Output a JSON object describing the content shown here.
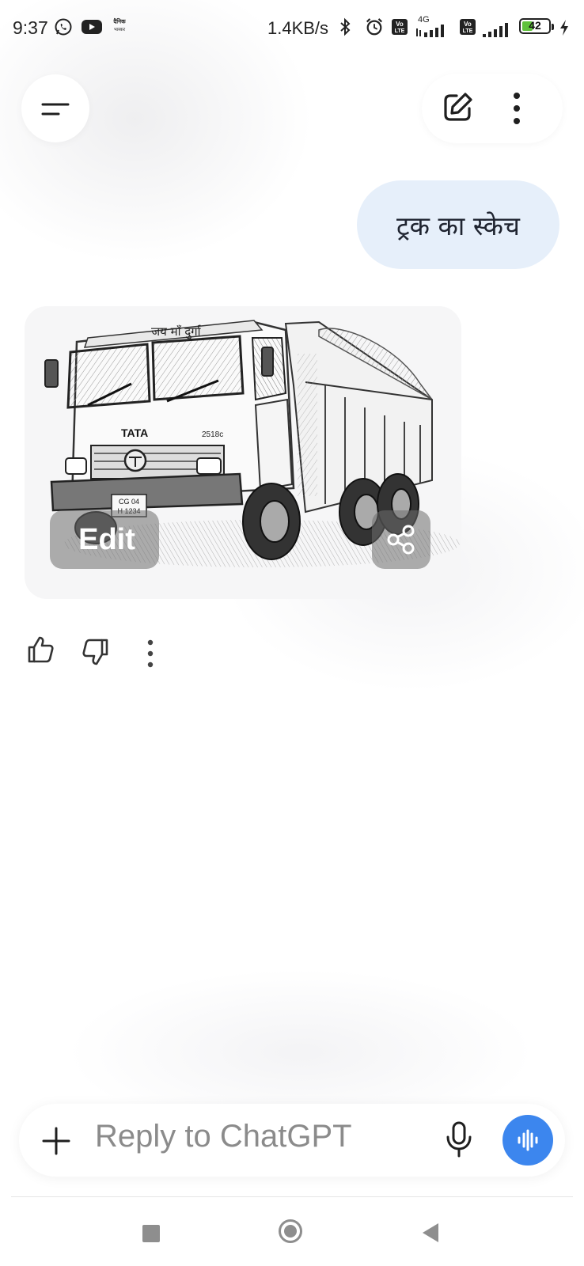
{
  "status_bar": {
    "time": "9:37",
    "left_icons": [
      "whatsapp-icon",
      "youtube-icon",
      "dainik-bhaskar-icon"
    ],
    "dainik_bhaskar_text": "दैनिक भास्कर",
    "net_speed": "1.4KB/s",
    "right_icons": [
      "bluetooth-icon",
      "alarm-icon",
      "volte-icon",
      "signal-4g-icon",
      "volte-icon",
      "signal-icon"
    ],
    "network_type": "4G",
    "volte_label": "Vo LTE",
    "battery_level": "42",
    "battery_fraction": 0.42,
    "charging": true
  },
  "header": {
    "menu_icon": "menu-icon",
    "new_chat_icon": "edit-square-icon",
    "more_icon": "more-vertical-icon"
  },
  "conversation": {
    "user_message": "ट्रक का स्केच",
    "assistant_image": {
      "subject": "pencil sketch of a TATA dump truck",
      "windshield_text": "जय माँ दुर्गा",
      "brand_text": "TATA",
      "model_text": "2518c",
      "plate_line1": "CG 04",
      "plate_line2": "H 1234",
      "edit_label": "Edit",
      "share_icon": "share-icon"
    },
    "feedback_icons": [
      "thumbs-up-icon",
      "thumbs-down-icon",
      "more-vertical-icon"
    ]
  },
  "composer": {
    "plus_icon": "plus-icon",
    "placeholder": "Reply to ChatGPT",
    "mic_icon": "mic-icon",
    "voice_icon": "voice-waveform-icon"
  },
  "nav_bar": {
    "icons": [
      "recents-square-icon",
      "home-circle-icon",
      "back-triangle-icon"
    ]
  },
  "colors": {
    "user_bubble": "#e6effa",
    "voice_button": "#3c86ee",
    "battery_fill": "#5ec13b",
    "nav_gray": "#8e8e8e"
  }
}
